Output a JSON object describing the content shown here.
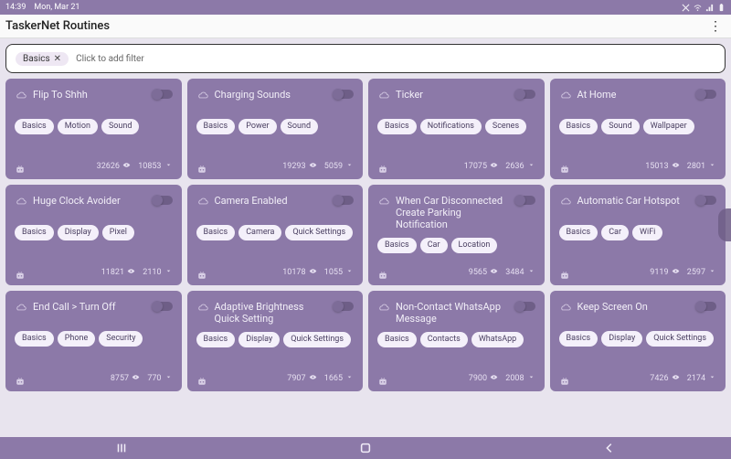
{
  "statusbar": {
    "time": "14:39",
    "date": "Mon, Mar 21"
  },
  "header": {
    "title": "TaskerNet Routines",
    "menu_glyph": "⋮"
  },
  "filter": {
    "chip_label": "Basics",
    "chip_close": "✕",
    "placeholder": "Click to add filter"
  },
  "cards": [
    {
      "title": "Flip To Shhh",
      "tags": [
        "Basics",
        "Motion",
        "Sound"
      ],
      "views": "32626",
      "downloads": "10853"
    },
    {
      "title": "Charging Sounds",
      "tags": [
        "Basics",
        "Power",
        "Sound"
      ],
      "views": "19293",
      "downloads": "5059"
    },
    {
      "title": "Ticker",
      "tags": [
        "Basics",
        "Notifications",
        "Scenes"
      ],
      "views": "17075",
      "downloads": "2636"
    },
    {
      "title": "At Home",
      "tags": [
        "Basics",
        "Sound",
        "Wallpaper"
      ],
      "views": "15013",
      "downloads": "2801"
    },
    {
      "title": "Huge Clock Avoider",
      "tags": [
        "Basics",
        "Display",
        "Pixel"
      ],
      "views": "11821",
      "downloads": "2110"
    },
    {
      "title": "Camera Enabled",
      "tags": [
        "Basics",
        "Camera",
        "Quick Settings"
      ],
      "views": "10178",
      "downloads": "1055"
    },
    {
      "title": "When Car Disconnected Create Parking Notification",
      "tags": [
        "Basics",
        "Car",
        "Location"
      ],
      "views": "9565",
      "downloads": "3484"
    },
    {
      "title": "Automatic Car Hotspot",
      "tags": [
        "Basics",
        "Car",
        "WiFi"
      ],
      "views": "9119",
      "downloads": "2597"
    },
    {
      "title": "End Call > Turn Off",
      "tags": [
        "Basics",
        "Phone",
        "Security"
      ],
      "views": "8757",
      "downloads": "770"
    },
    {
      "title": "Adaptive Brightness Quick Setting",
      "tags": [
        "Basics",
        "Display",
        "Quick Settings"
      ],
      "views": "7907",
      "downloads": "1665"
    },
    {
      "title": "Non-Contact WhatsApp Message",
      "tags": [
        "Basics",
        "Contacts",
        "WhatsApp"
      ],
      "views": "7900",
      "downloads": "2008"
    },
    {
      "title": "Keep Screen On",
      "tags": [
        "Basics",
        "Display",
        "Quick Settings"
      ],
      "views": "7426",
      "downloads": "2174"
    }
  ]
}
